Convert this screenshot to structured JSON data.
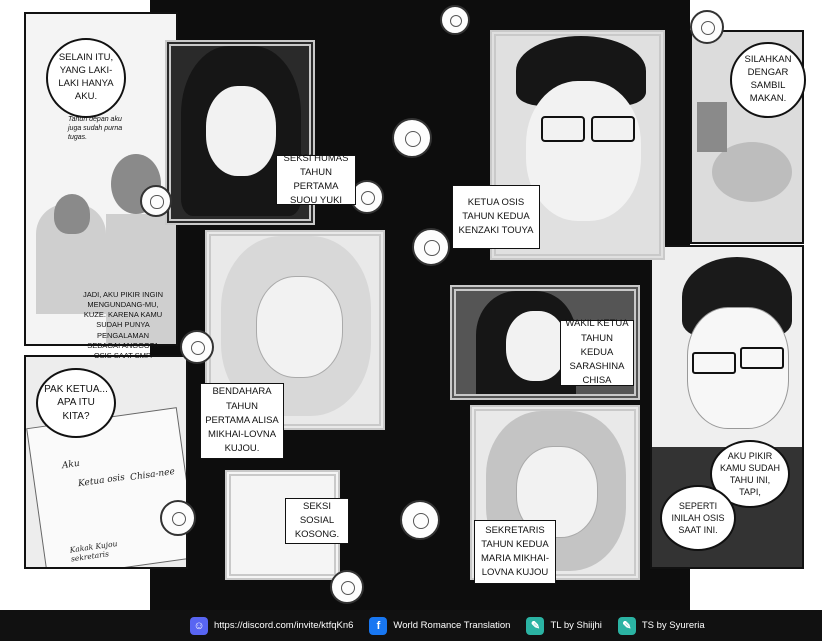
{
  "bubbles": {
    "top_left": "SELAIN ITU, YANG LAKI-LAKI HANYA AKU.",
    "top_left_note": "Tahun depan aku juga sudah purna tugas.",
    "mid_left": "JADI, AKU PIKIR INGIN MENGUNDANG-MU, KUZE. KARENA KAMU SUDAH PUNYA PENGALAMAN SEBAGAI ANGGOTA OSIS SAAT SMP.",
    "lower_left": "PAK KETUA... APA ITU KITA?",
    "top_right": "SILAHKAN DENGAR SAMBIL MAKAN.",
    "right_1": "AKU PIKIR KAMU SUDAH TAHU INI, TAPI,",
    "right_2": "SEPERTI INILAH OSIS SAAT INI."
  },
  "captions": {
    "yuki": "SEKSI HUMAS TAHUN PERTAMA SUOU YUKI",
    "touya": "KETUA OSIS TAHUN KEDUA KENZAKI TOUYA",
    "chisa": "WAKIL KETUA TAHUN KEDUA SARASHINA CHISA",
    "alisa": "BENDAHARA TAHUN PERTAMA ALISA MIKHAI-LOVNA KUJOU.",
    "sosial": "SEKSI SOSIAL KOSONG.",
    "maria": "SEKRETARIS TAHUN KEDUA MARIA MIKHAI-LOVNA KUJOU"
  },
  "notebook": {
    "aku": "Aku",
    "ketua": "Ketua osis",
    "chisa": "Chisa-nee",
    "kakak": "Kakak Kujou sekretaris"
  },
  "footer": {
    "discord": "https://discord.com/invite/ktfqKn6",
    "fb": "World Romance Translation",
    "tl": "TL by Shiijhi",
    "ts": "TS by Syureria"
  },
  "colors": {
    "footer_bg": "#111111",
    "discord": "#5865F2",
    "facebook": "#1877F2",
    "credit": "#2bb3a3"
  }
}
